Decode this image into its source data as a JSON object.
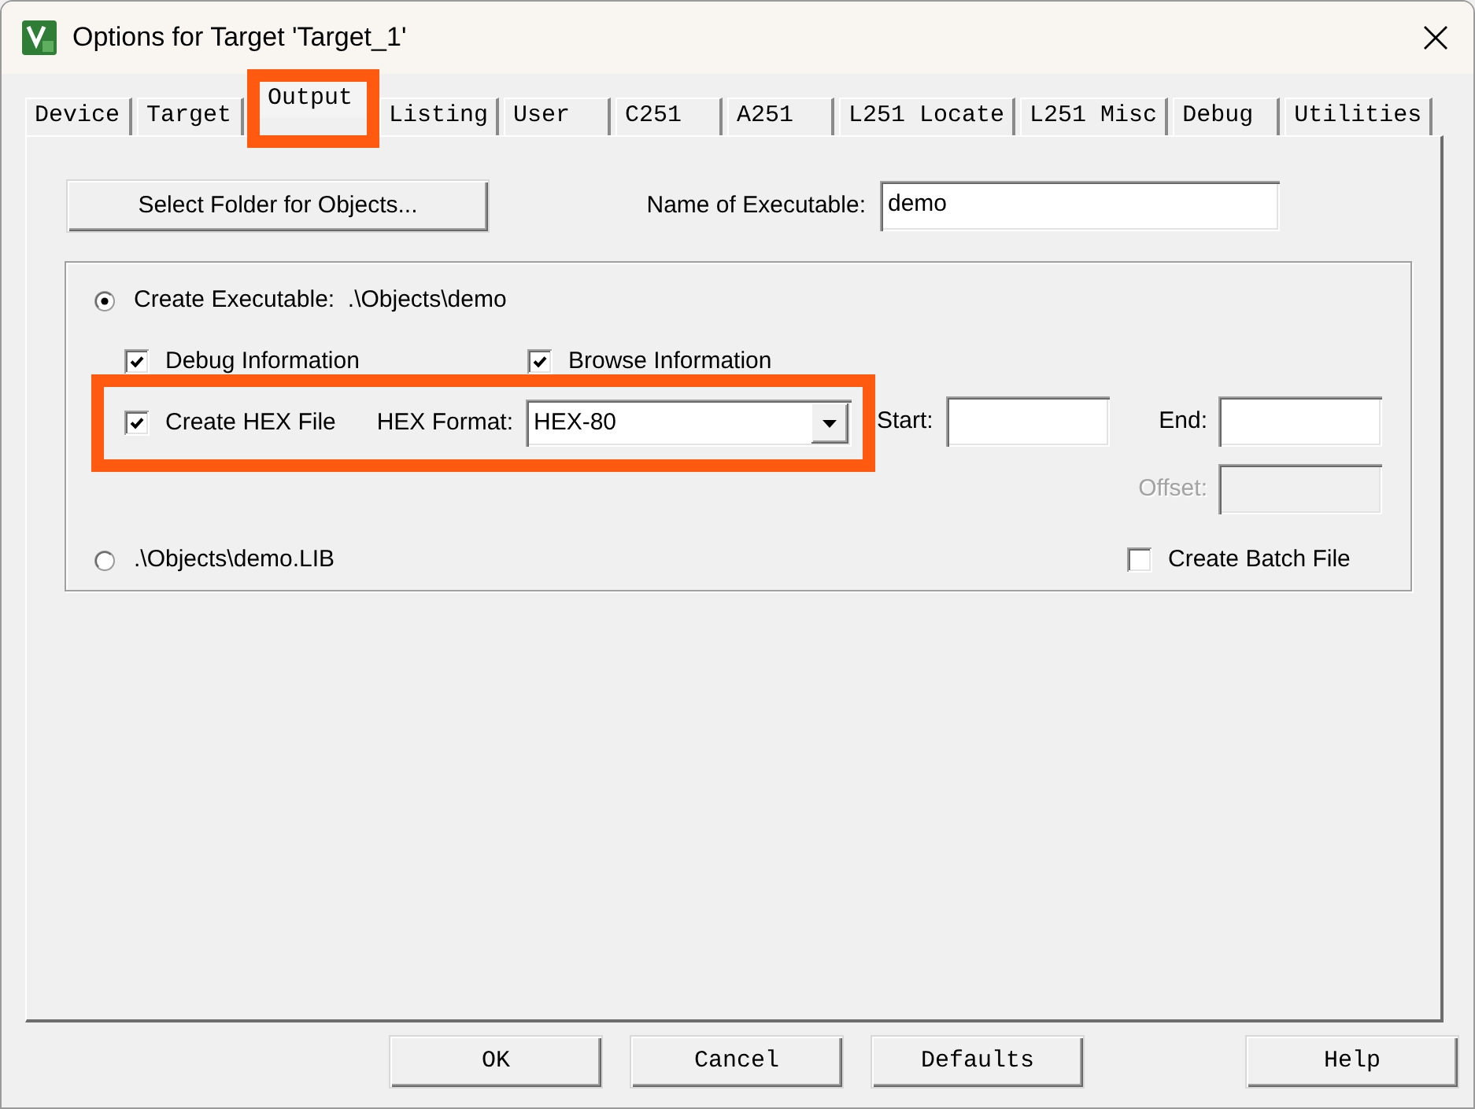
{
  "window": {
    "title": "Options for Target 'Target_1'"
  },
  "tabs": [
    {
      "label": "Device",
      "selected": false,
      "highlighted": false
    },
    {
      "label": "Target",
      "selected": false,
      "highlighted": false
    },
    {
      "label": "Output",
      "selected": true,
      "highlighted": true
    },
    {
      "label": "Listing",
      "selected": false,
      "highlighted": false
    },
    {
      "label": "User",
      "selected": false,
      "highlighted": false
    },
    {
      "label": "C251",
      "selected": false,
      "highlighted": false
    },
    {
      "label": "A251",
      "selected": false,
      "highlighted": false
    },
    {
      "label": "L251 Locate",
      "selected": false,
      "highlighted": false
    },
    {
      "label": "L251 Misc",
      "selected": false,
      "highlighted": false
    },
    {
      "label": "Debug",
      "selected": false,
      "highlighted": false
    },
    {
      "label": "Utilities",
      "selected": false,
      "highlighted": false
    }
  ],
  "output_panel": {
    "folder_button": {
      "label": "Select Folder for Objects..."
    },
    "executable_name": {
      "label": "Name of Executable:",
      "value": "demo"
    },
    "output_type": [
      {
        "label": "Create Executable:  .\\Objects\\demo",
        "selected": true
      },
      {
        "label": ".\\Objects\\demo.LIB",
        "selected": false
      }
    ],
    "debug_information": {
      "label": "Debug Information",
      "checked": true
    },
    "browse_information": {
      "label": "Browse Information",
      "checked": true
    },
    "hex_row": {
      "highlighted": true,
      "create_hex_file": {
        "label": "Create HEX File",
        "checked": true
      },
      "hex_format": {
        "label": "HEX Format:",
        "value": "HEX-80"
      }
    },
    "start": {
      "label": "Start:",
      "disabled": false
    },
    "end": {
      "label": "End:",
      "disabled": false
    },
    "offset": {
      "label": "Offset:",
      "disabled": true
    },
    "create_batch_file": {
      "label": "Create Batch File",
      "checked": false
    }
  },
  "buttons": [
    {
      "label": "OK"
    },
    {
      "label": "Cancel"
    },
    {
      "label": "Defaults"
    },
    {
      "label": "Help"
    }
  ]
}
